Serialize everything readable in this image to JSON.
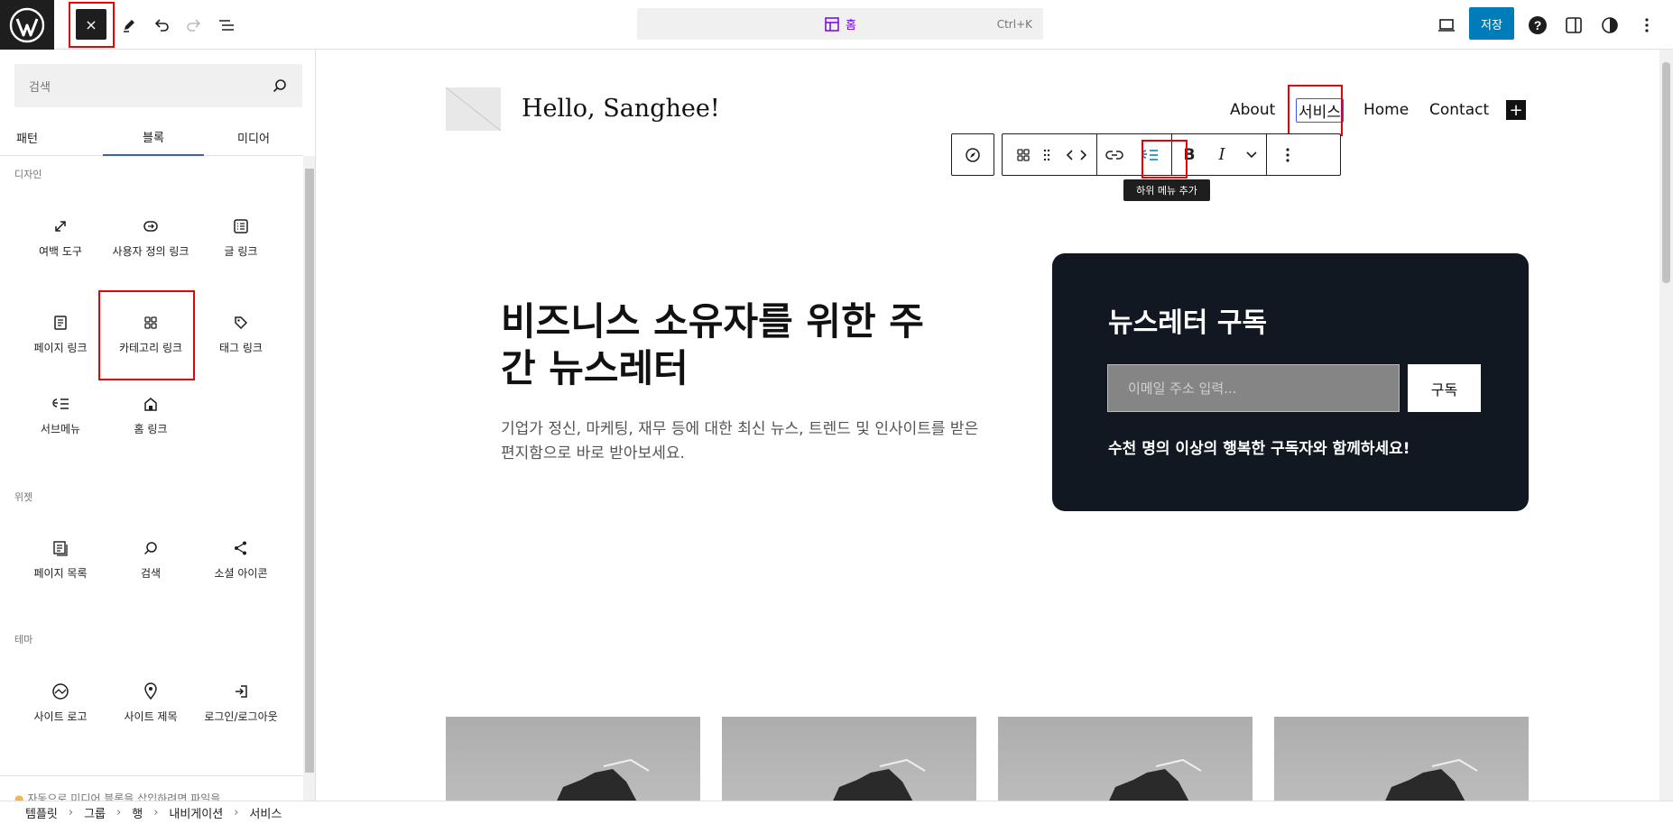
{
  "topbar": {
    "close_label": "×",
    "command": {
      "title": "홈",
      "shortcut": "Ctrl+K"
    },
    "save_label": "저장"
  },
  "sidebar": {
    "search_placeholder": "검색",
    "tabs": [
      {
        "label": "패턴"
      },
      {
        "label": "블록"
      },
      {
        "label": "미디어"
      }
    ],
    "sections": [
      {
        "label": "디자인",
        "items": [
          {
            "label": "여백 도구",
            "icon": "resize-icon"
          },
          {
            "label": "사용자 정의 링크",
            "icon": "custom-link-icon"
          },
          {
            "label": "글 링크",
            "icon": "post-link-icon"
          },
          {
            "label": "페이지 링크",
            "icon": "page-link-icon"
          },
          {
            "label": "카테고리 링크",
            "icon": "category-icon"
          },
          {
            "label": "태그 링크",
            "icon": "tag-icon"
          },
          {
            "label": "서브메뉴",
            "icon": "submenu-icon"
          },
          {
            "label": "홈 링크",
            "icon": "home-icon"
          }
        ]
      },
      {
        "label": "위젯",
        "items": [
          {
            "label": "페이지 목록",
            "icon": "page-list-icon"
          },
          {
            "label": "검색",
            "icon": "search-icon"
          },
          {
            "label": "소셜 아이콘",
            "icon": "share-icon"
          }
        ]
      },
      {
        "label": "테마",
        "items": [
          {
            "label": "사이트 로고",
            "icon": "site-logo-icon"
          },
          {
            "label": "사이트 제목",
            "icon": "location-icon"
          },
          {
            "label": "로그인/로그아웃",
            "icon": "login-icon"
          }
        ]
      }
    ],
    "notice": "자동으로 미디어 블록을 삽입하려면 파일을"
  },
  "breadcrumb": [
    "템플릿",
    "그룹",
    "행",
    "내비게이션",
    "서비스"
  ],
  "canvas": {
    "site_title": "Hello, Sanghee!",
    "nav": [
      "About",
      "서비스",
      "Home",
      "Contact"
    ],
    "tooltip": "하위 메뉴 추가",
    "hero": {
      "title": "비즈니스 소유자를 위한 주간 뉴스레터",
      "subtitle": "기업가 정신, 마케팅, 재무 등에 대한 최신 뉴스, 트렌드 및 인사이트를 받은 편지함으로 바로 받아보세요."
    },
    "newsletter": {
      "title": "뉴스레터 구독",
      "email_placeholder": "이메일 주소 입력...",
      "button": "구독",
      "note": "수천 명의 이상의 행복한 구독자와 함께하세요!"
    }
  },
  "colors": {
    "accent": "#3858e9",
    "save": "#007cba",
    "dark": "#1e1e1e",
    "card": "#111822",
    "highlight": "#ee0000"
  }
}
